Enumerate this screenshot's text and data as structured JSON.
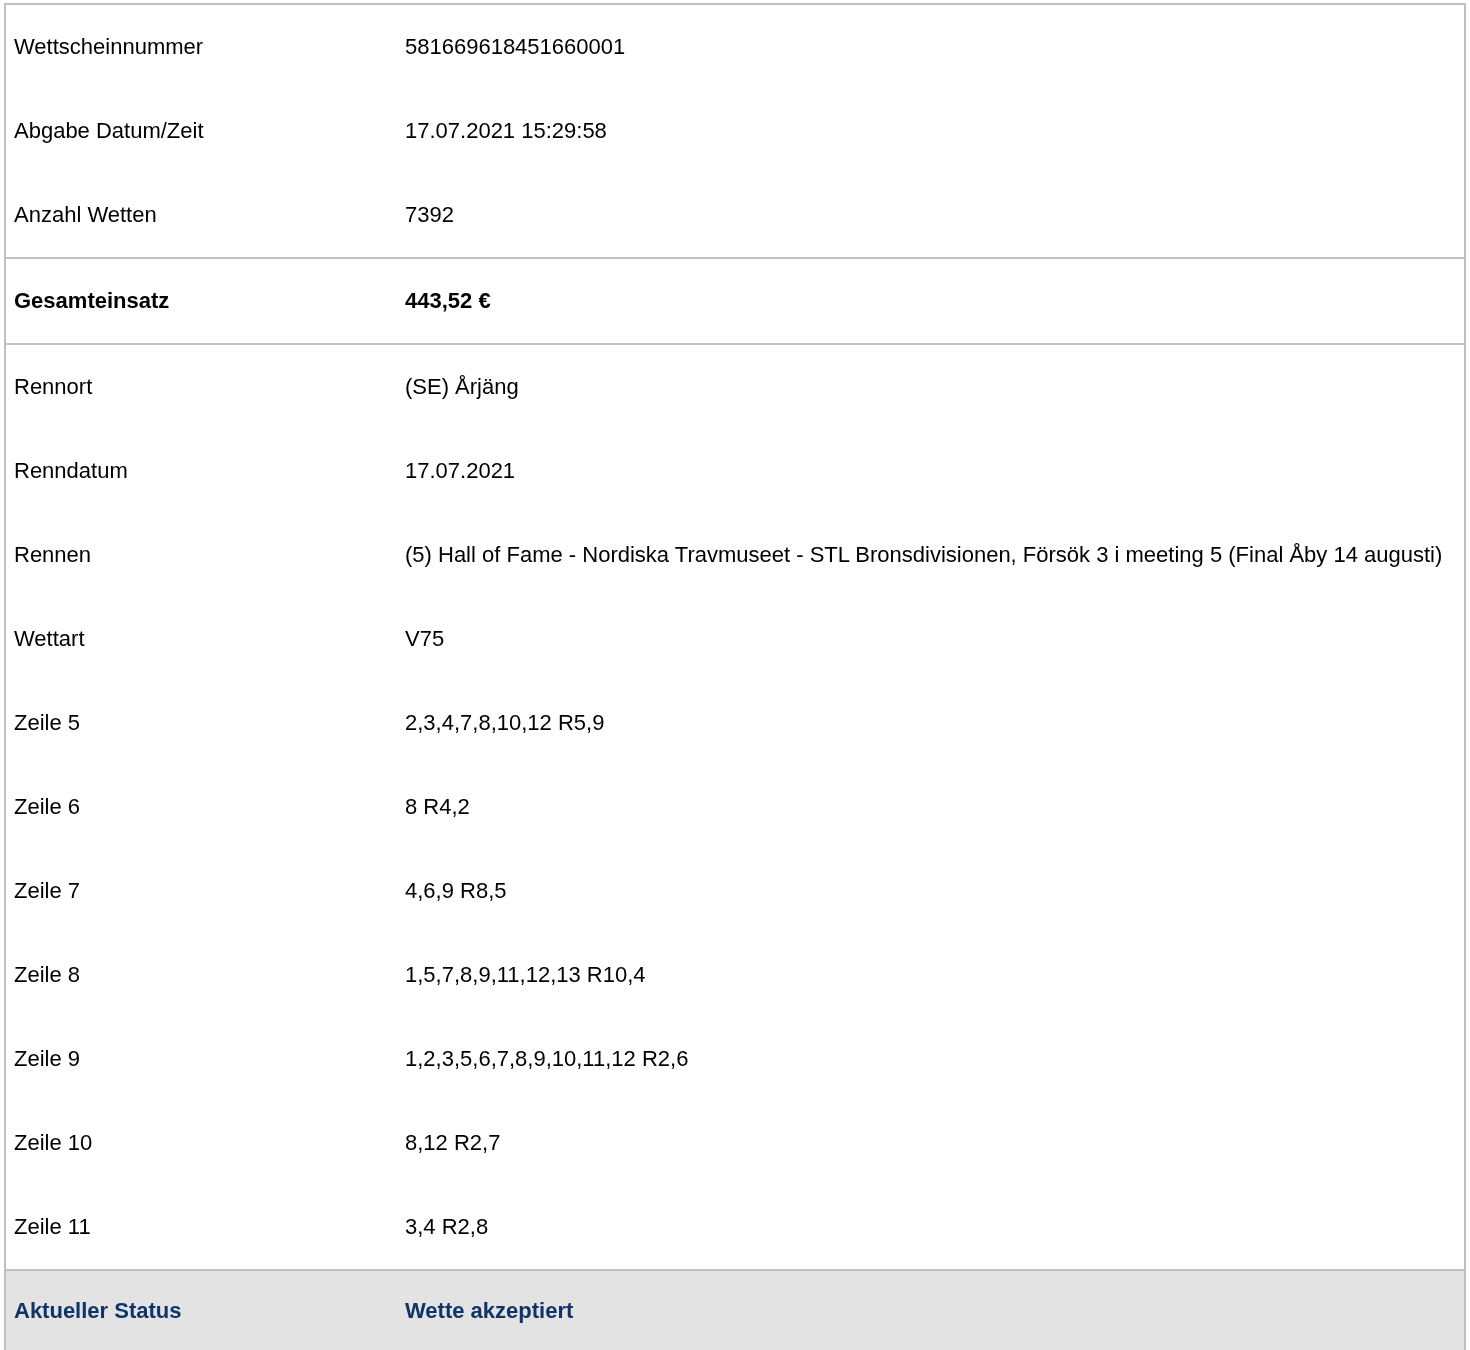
{
  "groups": [
    {
      "kind": "details",
      "rows": [
        {
          "label": "Wettscheinnummer",
          "value": "581669618451660001"
        },
        {
          "label": "Abgabe Datum/Zeit",
          "value": "17.07.2021 15:29:58"
        },
        {
          "label": "Anzahl Wetten",
          "value": "7392"
        }
      ]
    },
    {
      "kind": "total",
      "rows": [
        {
          "label": "Gesamteinsatz",
          "value": "443,52 €"
        }
      ]
    },
    {
      "kind": "details",
      "rows": [
        {
          "label": "Rennort",
          "value": "(SE) Årjäng"
        },
        {
          "label": "Renndatum",
          "value": "17.07.2021"
        },
        {
          "label": "Rennen",
          "value": "(5) Hall of Fame - Nordiska Travmuseet - STL Bronsdivisionen, Försök 3 i meeting 5 (Final Åby 14 augusti)"
        },
        {
          "label": "Wettart",
          "value": "V75"
        },
        {
          "label": "Zeile 5",
          "value": "2,3,4,7,8,10,12 R5,9"
        },
        {
          "label": "Zeile 6",
          "value": "8 R4,2"
        },
        {
          "label": "Zeile 7",
          "value": "4,6,9 R8,5"
        },
        {
          "label": "Zeile 8",
          "value": "1,5,7,8,9,11,12,13 R10,4"
        },
        {
          "label": "Zeile 9",
          "value": "1,2,3,5,6,7,8,9,10,11,12 R2,6"
        },
        {
          "label": "Zeile 10",
          "value": "8,12 R2,7"
        },
        {
          "label": "Zeile 11",
          "value": "3,4 R2,8"
        }
      ]
    },
    {
      "kind": "status",
      "rows": [
        {
          "label": "Aktueller Status",
          "value": "Wette akzeptiert"
        }
      ]
    }
  ]
}
